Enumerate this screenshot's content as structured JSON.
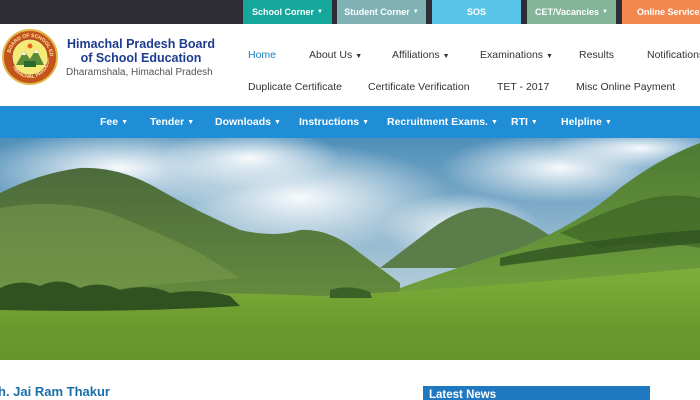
{
  "top_tabs": [
    {
      "label": "School Corner",
      "caret": true,
      "color": "#16a79b"
    },
    {
      "label": "Student Corner",
      "caret": true,
      "color": "#7fb1b5"
    },
    {
      "label": "SOS",
      "caret": false,
      "color": "#5bc5e9"
    },
    {
      "label": "CET/Vacancies",
      "caret": true,
      "color": "#84b59a"
    },
    {
      "label": "Online Services",
      "caret": false,
      "color": "#f2884f"
    }
  ],
  "header": {
    "org_name": "Himachal Pradesh Board of School Education",
    "org_location": "Dharamshala, Himachal Pradesh",
    "logo_text_top": "BOARD OF SCHOOL EDU",
    "logo_text_bottom": "HIMACHAL PRADESH"
  },
  "main_nav": {
    "row1": [
      {
        "label": "Home",
        "caret": false,
        "active": true
      },
      {
        "label": "About Us",
        "caret": true
      },
      {
        "label": "Affiliations",
        "caret": true
      },
      {
        "label": "Examinations",
        "caret": true
      },
      {
        "label": "Results",
        "caret": false
      },
      {
        "label": "Notifications",
        "caret": false
      }
    ],
    "row2": [
      {
        "label": "Duplicate Certificate"
      },
      {
        "label": "Certificate Verification"
      },
      {
        "label": "TET - 2017"
      },
      {
        "label": "Misc Online Payment"
      }
    ]
  },
  "blue_nav": [
    {
      "label": "Fee"
    },
    {
      "label": "Tender"
    },
    {
      "label": "Downloads"
    },
    {
      "label": "Instructions"
    },
    {
      "label": "Recruitment Exams."
    },
    {
      "label": "RTI"
    },
    {
      "label": "Helpline"
    }
  ],
  "caret_glyph": "▾",
  "bottom": {
    "person_name": "h. Jai Ram Thakur",
    "latest_news_label": "Latest News"
  },
  "colors": {
    "accent_blue": "#1f8ed6",
    "title_blue": "#1d3b8f",
    "active_link": "#1a7fbf"
  }
}
